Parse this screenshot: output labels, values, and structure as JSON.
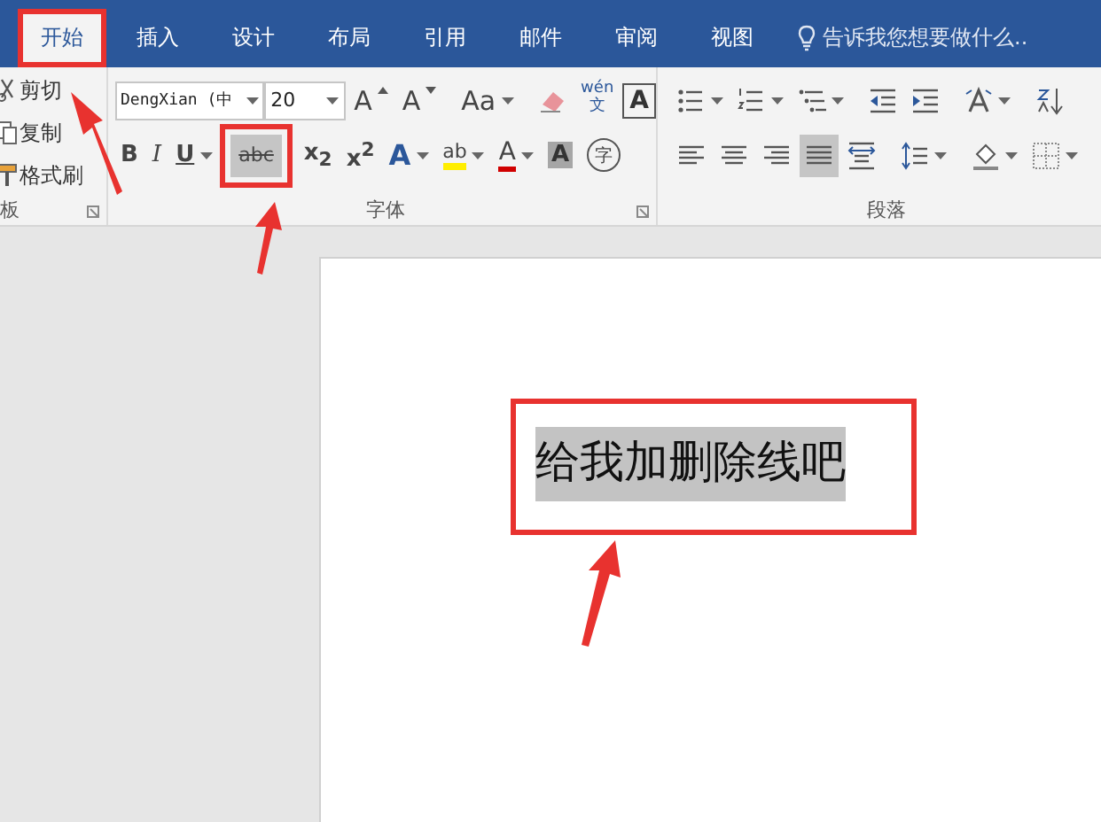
{
  "tabs": [
    {
      "label": "开始",
      "selected": true,
      "annotated": true
    },
    {
      "label": "插入",
      "selected": false,
      "annotated": false
    },
    {
      "label": "设计",
      "selected": false,
      "annotated": false
    },
    {
      "label": "布局",
      "selected": false,
      "annotated": false
    },
    {
      "label": "引用",
      "selected": false,
      "annotated": false
    },
    {
      "label": "邮件",
      "selected": false,
      "annotated": false
    },
    {
      "label": "审阅",
      "selected": false,
      "annotated": false
    },
    {
      "label": "视图",
      "selected": false,
      "annotated": false
    }
  ],
  "tell_me": {
    "placeholder": "告诉我您想要做什么.."
  },
  "clipboard": {
    "items": [
      {
        "kind": "cut",
        "label": "剪切"
      },
      {
        "kind": "copy",
        "label": "复制"
      },
      {
        "kind": "painter",
        "label": "格式刷"
      }
    ],
    "label": "板"
  },
  "font": {
    "name": "DengXian (中",
    "size": "20",
    "label": "字体",
    "row1": [
      {
        "kind": "grow",
        "label": "A"
      },
      {
        "kind": "shrink",
        "label": "A"
      },
      {
        "kind": "case",
        "label": "Aa"
      },
      {
        "kind": "clear"
      },
      {
        "kind": "phonetic",
        "label": "wén",
        "sub": "文"
      },
      {
        "kind": "boxed",
        "label": "A"
      }
    ],
    "row2": [
      {
        "kind": "bold",
        "label": "B",
        "selected": false,
        "annotated": false
      },
      {
        "kind": "italic",
        "label": "I",
        "selected": false,
        "annotated": false
      },
      {
        "kind": "underline",
        "label": "U",
        "selected": false,
        "annotated": false
      },
      {
        "kind": "strike",
        "label": "abc",
        "selected": true,
        "annotated": true
      },
      {
        "kind": "sub",
        "label": "x$_{2}$",
        "selected": false,
        "annotated": false
      },
      {
        "kind": "sup",
        "label": "x$^{2}$",
        "selected": false,
        "annotated": false
      },
      {
        "kind": "effect",
        "label": "A",
        "selected": false,
        "annotated": false
      },
      {
        "kind": "highlight",
        "label": "ab",
        "selected": false,
        "annotated": false
      },
      {
        "kind": "color",
        "label": "A",
        "selected": false,
        "annotated": false
      },
      {
        "kind": "shade",
        "label": "A",
        "selected": false,
        "annotated": false
      },
      {
        "kind": "enclose",
        "label": "字",
        "selected": false,
        "annotated": false
      }
    ]
  },
  "paragraph": {
    "label": "段落",
    "row1": [
      {
        "kind": "bullets"
      },
      {
        "kind": "numbering"
      },
      {
        "kind": "multilevel"
      },
      {
        "kind": "outdent"
      },
      {
        "kind": "indent"
      },
      {
        "kind": "asian"
      },
      {
        "kind": "sort"
      }
    ],
    "row2": [
      {
        "kind": "left",
        "selected": false
      },
      {
        "kind": "center",
        "selected": false
      },
      {
        "kind": "right",
        "selected": false
      },
      {
        "kind": "justify",
        "selected": true
      },
      {
        "kind": "distributed",
        "selected": false
      },
      {
        "kind": "spacing",
        "selected": false
      },
      {
        "kind": "shading",
        "selected": false
      },
      {
        "kind": "borders",
        "selected": false
      }
    ]
  },
  "document": {
    "text": "给我加删除线吧",
    "selected": true,
    "annotated": true
  }
}
